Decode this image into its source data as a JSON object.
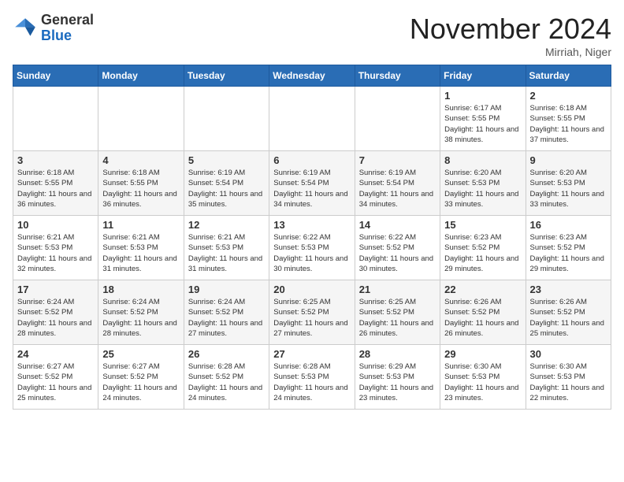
{
  "header": {
    "logo_general": "General",
    "logo_blue": "Blue",
    "month_title": "November 2024",
    "location": "Mirriah, Niger"
  },
  "days_of_week": [
    "Sunday",
    "Monday",
    "Tuesday",
    "Wednesday",
    "Thursday",
    "Friday",
    "Saturday"
  ],
  "weeks": [
    [
      {
        "day": "",
        "info": ""
      },
      {
        "day": "",
        "info": ""
      },
      {
        "day": "",
        "info": ""
      },
      {
        "day": "",
        "info": ""
      },
      {
        "day": "",
        "info": ""
      },
      {
        "day": "1",
        "info": "Sunrise: 6:17 AM\nSunset: 5:55 PM\nDaylight: 11 hours and 38 minutes."
      },
      {
        "day": "2",
        "info": "Sunrise: 6:18 AM\nSunset: 5:55 PM\nDaylight: 11 hours and 37 minutes."
      }
    ],
    [
      {
        "day": "3",
        "info": "Sunrise: 6:18 AM\nSunset: 5:55 PM\nDaylight: 11 hours and 36 minutes."
      },
      {
        "day": "4",
        "info": "Sunrise: 6:18 AM\nSunset: 5:55 PM\nDaylight: 11 hours and 36 minutes."
      },
      {
        "day": "5",
        "info": "Sunrise: 6:19 AM\nSunset: 5:54 PM\nDaylight: 11 hours and 35 minutes."
      },
      {
        "day": "6",
        "info": "Sunrise: 6:19 AM\nSunset: 5:54 PM\nDaylight: 11 hours and 34 minutes."
      },
      {
        "day": "7",
        "info": "Sunrise: 6:19 AM\nSunset: 5:54 PM\nDaylight: 11 hours and 34 minutes."
      },
      {
        "day": "8",
        "info": "Sunrise: 6:20 AM\nSunset: 5:53 PM\nDaylight: 11 hours and 33 minutes."
      },
      {
        "day": "9",
        "info": "Sunrise: 6:20 AM\nSunset: 5:53 PM\nDaylight: 11 hours and 33 minutes."
      }
    ],
    [
      {
        "day": "10",
        "info": "Sunrise: 6:21 AM\nSunset: 5:53 PM\nDaylight: 11 hours and 32 minutes."
      },
      {
        "day": "11",
        "info": "Sunrise: 6:21 AM\nSunset: 5:53 PM\nDaylight: 11 hours and 31 minutes."
      },
      {
        "day": "12",
        "info": "Sunrise: 6:21 AM\nSunset: 5:53 PM\nDaylight: 11 hours and 31 minutes."
      },
      {
        "day": "13",
        "info": "Sunrise: 6:22 AM\nSunset: 5:53 PM\nDaylight: 11 hours and 30 minutes."
      },
      {
        "day": "14",
        "info": "Sunrise: 6:22 AM\nSunset: 5:52 PM\nDaylight: 11 hours and 30 minutes."
      },
      {
        "day": "15",
        "info": "Sunrise: 6:23 AM\nSunset: 5:52 PM\nDaylight: 11 hours and 29 minutes."
      },
      {
        "day": "16",
        "info": "Sunrise: 6:23 AM\nSunset: 5:52 PM\nDaylight: 11 hours and 29 minutes."
      }
    ],
    [
      {
        "day": "17",
        "info": "Sunrise: 6:24 AM\nSunset: 5:52 PM\nDaylight: 11 hours and 28 minutes."
      },
      {
        "day": "18",
        "info": "Sunrise: 6:24 AM\nSunset: 5:52 PM\nDaylight: 11 hours and 28 minutes."
      },
      {
        "day": "19",
        "info": "Sunrise: 6:24 AM\nSunset: 5:52 PM\nDaylight: 11 hours and 27 minutes."
      },
      {
        "day": "20",
        "info": "Sunrise: 6:25 AM\nSunset: 5:52 PM\nDaylight: 11 hours and 27 minutes."
      },
      {
        "day": "21",
        "info": "Sunrise: 6:25 AM\nSunset: 5:52 PM\nDaylight: 11 hours and 26 minutes."
      },
      {
        "day": "22",
        "info": "Sunrise: 6:26 AM\nSunset: 5:52 PM\nDaylight: 11 hours and 26 minutes."
      },
      {
        "day": "23",
        "info": "Sunrise: 6:26 AM\nSunset: 5:52 PM\nDaylight: 11 hours and 25 minutes."
      }
    ],
    [
      {
        "day": "24",
        "info": "Sunrise: 6:27 AM\nSunset: 5:52 PM\nDaylight: 11 hours and 25 minutes."
      },
      {
        "day": "25",
        "info": "Sunrise: 6:27 AM\nSunset: 5:52 PM\nDaylight: 11 hours and 24 minutes."
      },
      {
        "day": "26",
        "info": "Sunrise: 6:28 AM\nSunset: 5:52 PM\nDaylight: 11 hours and 24 minutes."
      },
      {
        "day": "27",
        "info": "Sunrise: 6:28 AM\nSunset: 5:53 PM\nDaylight: 11 hours and 24 minutes."
      },
      {
        "day": "28",
        "info": "Sunrise: 6:29 AM\nSunset: 5:53 PM\nDaylight: 11 hours and 23 minutes."
      },
      {
        "day": "29",
        "info": "Sunrise: 6:30 AM\nSunset: 5:53 PM\nDaylight: 11 hours and 23 minutes."
      },
      {
        "day": "30",
        "info": "Sunrise: 6:30 AM\nSunset: 5:53 PM\nDaylight: 11 hours and 22 minutes."
      }
    ]
  ]
}
